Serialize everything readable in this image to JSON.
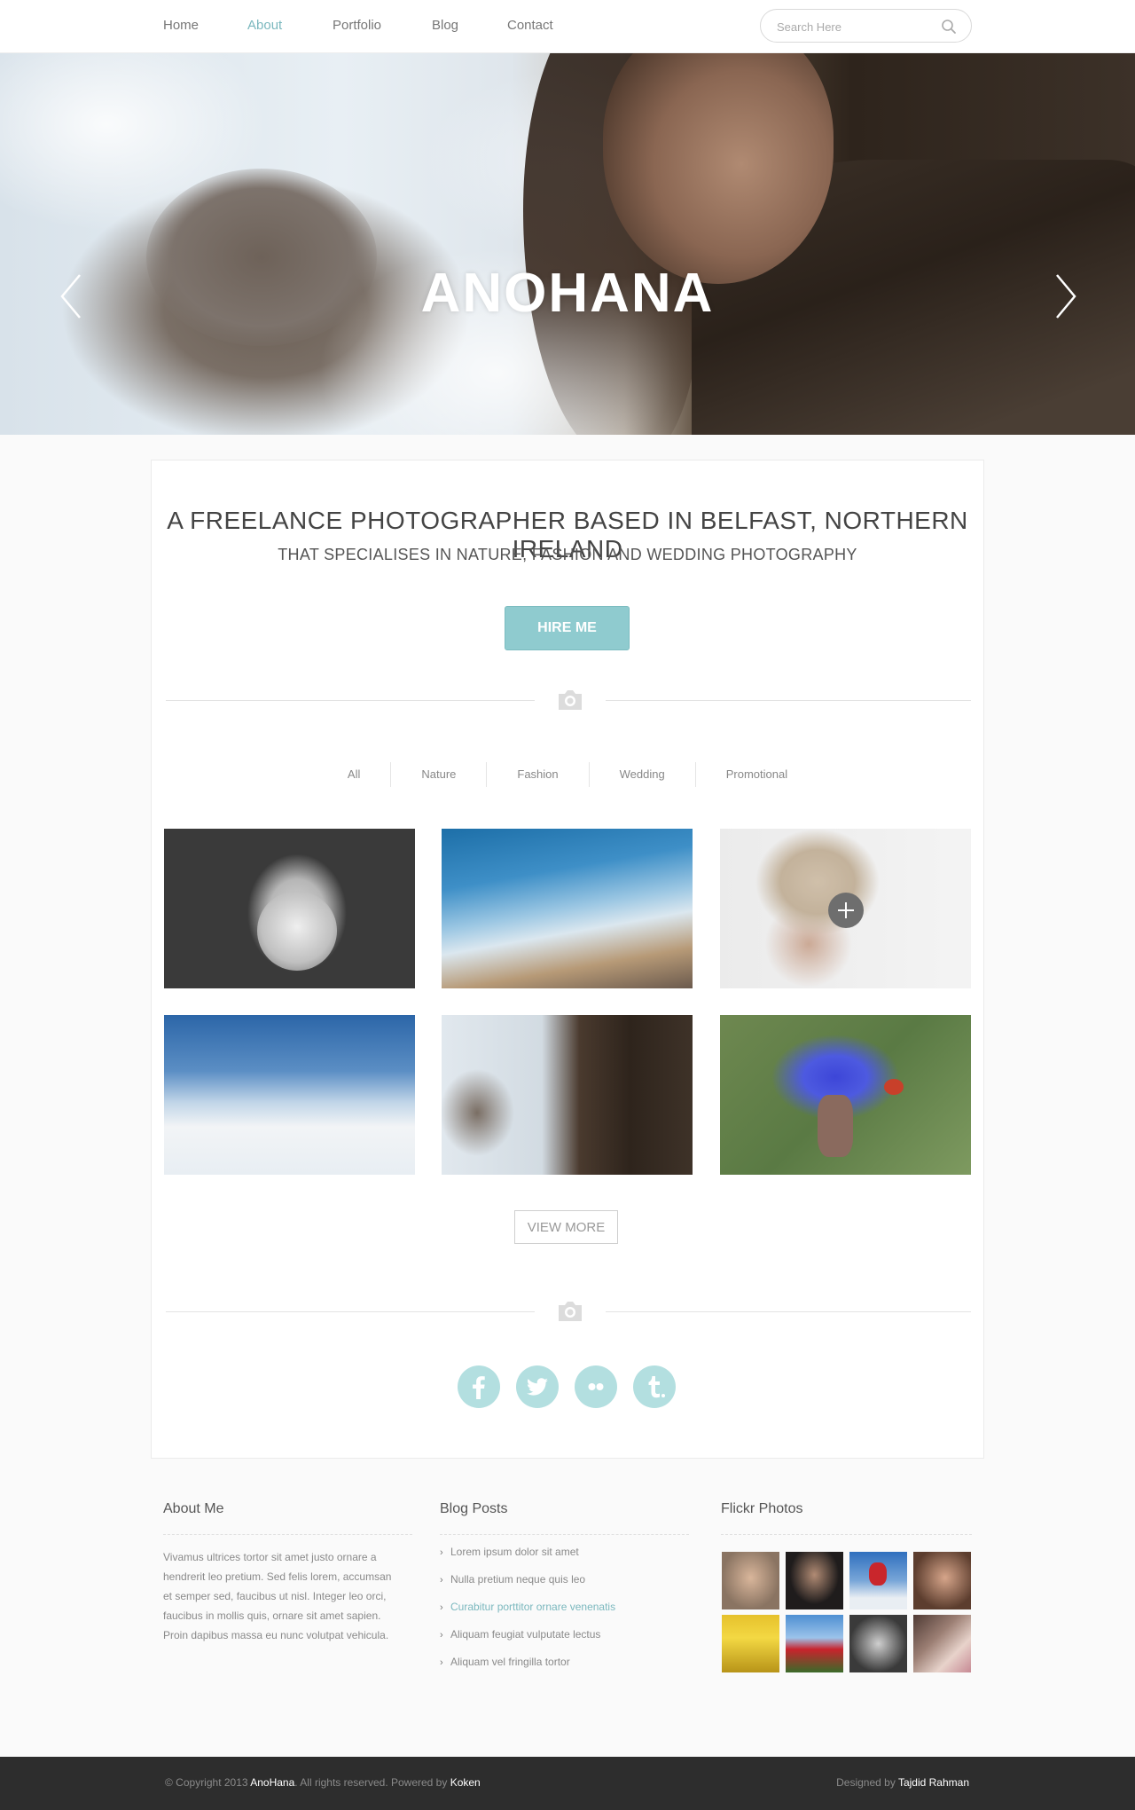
{
  "nav": {
    "items": [
      {
        "label": "Home",
        "active": false
      },
      {
        "label": "About",
        "active": true
      },
      {
        "label": "Portfolio",
        "active": false
      },
      {
        "label": "Blog",
        "active": false
      },
      {
        "label": "Contact",
        "active": false
      }
    ],
    "search_placeholder": "Search Here",
    "active_color": "#7bb8be"
  },
  "hero": {
    "title": "ANOHANA",
    "prev_icon": "chevron-left-icon",
    "next_icon": "chevron-right-icon"
  },
  "intro": {
    "headline": "A FREELANCE PHOTOGRAPHER BASED IN BELFAST, NORTHERN IRELAND",
    "subhead": "THAT SPECIALISES IN NATURE, FASHION AND WEDDING PHOTOGRAPHY",
    "cta_label": "HIRE ME",
    "cta_color": "#8fcbcf"
  },
  "portfolio": {
    "filters": [
      "All",
      "Nature",
      "Fashion",
      "Wedding",
      "Promotional"
    ],
    "view_more_label": "VIEW MORE"
  },
  "social": [
    "facebook-icon",
    "twitter-icon",
    "flickr-icon",
    "tumblr-icon"
  ],
  "footer": {
    "about": {
      "title": "About Me",
      "text": "Vivamus ultrices tortor sit amet justo ornare a hendrerit leo pretium. Sed felis lorem, accumsan et semper sed, faucibus ut nisl. Integer leo orci, faucibus in mollis quis, ornare sit amet sapien. Proin dapibus massa eu nunc volutpat vehicula."
    },
    "blog": {
      "title": "Blog Posts",
      "posts": [
        {
          "label": "Lorem ipsum dolor sit amet",
          "active": false
        },
        {
          "label": "Nulla pretium neque quis leo",
          "active": false
        },
        {
          "label": "Curabitur porttitor ornare venenatis",
          "active": true
        },
        {
          "label": "Aliquam feugiat vulputate lectus",
          "active": false
        },
        {
          "label": "Aliquam vel fringilla tortor",
          "active": false
        }
      ]
    },
    "flickr": {
      "title": "Flickr Photos"
    }
  },
  "bottom": {
    "copy_prefix": "© Copyright 2013 ",
    "brand": "AnoHana",
    "copy_middle": ". All rights reserved. Powered by ",
    "powered": "Koken",
    "designed_prefix": "Designed by ",
    "designer": "Tajdid Rahman"
  }
}
